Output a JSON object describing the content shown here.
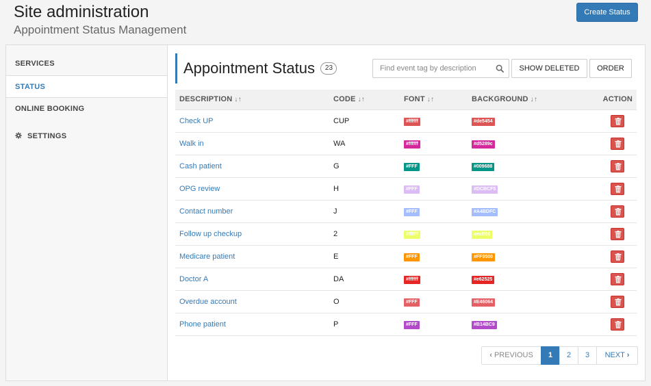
{
  "header": {
    "title": "Site administration",
    "subtitle": "Appointment Status Management",
    "create_label": "Create Status"
  },
  "sidebar": {
    "items": [
      {
        "label": "SERVICES"
      },
      {
        "label": "STATUS"
      },
      {
        "label": "ONLINE BOOKING"
      },
      {
        "label": "SETTINGS",
        "icon": "gear-icon"
      }
    ],
    "active_index": 1
  },
  "panel": {
    "title": "Appointment Status",
    "count": "23",
    "search_placeholder": "Find event tag by description",
    "show_deleted_label": "SHOW DELETED",
    "order_label": "ORDER"
  },
  "table": {
    "headers": {
      "description": "DESCRIPTION",
      "code": "CODE",
      "font": "FONT",
      "background": "BACKGROUND",
      "action": "ACTION"
    },
    "rows": [
      {
        "description": "Check UP",
        "code": "CUP",
        "font": "#ffffff",
        "background": "#de5454"
      },
      {
        "description": "Walk in",
        "code": "WA",
        "font": "#ffffff",
        "background": "#d5289c"
      },
      {
        "description": "Cash patient",
        "code": "G",
        "font": "#FFF",
        "background": "#009688"
      },
      {
        "description": "OPG review",
        "code": "H",
        "font": "#FFF",
        "background": "#DCBCF5"
      },
      {
        "description": "Contact number",
        "code": "J",
        "font": "#FFF",
        "background": "#A4BDFC"
      },
      {
        "description": "Follow up checkup",
        "code": "2",
        "font": "#ffffff",
        "background": "#ecff66"
      },
      {
        "description": "Medicare patient",
        "code": "E",
        "font": "#FFF",
        "background": "#FF9500"
      },
      {
        "description": "Doctor A",
        "code": "DA",
        "font": "#ffffff",
        "background": "#e62525"
      },
      {
        "description": "Overdue account",
        "code": "O",
        "font": "#FFF",
        "background": "#E46064"
      },
      {
        "description": "Phone patient",
        "code": "P",
        "font": "#FFF",
        "background": "#B14BC9"
      }
    ]
  },
  "pagination": {
    "previous_label": "PREVIOUS",
    "next_label": "NEXT",
    "pages": [
      "1",
      "2",
      "3"
    ],
    "active_page": "1"
  },
  "colors": {
    "accent": "#337ab7",
    "delete": "#d9534f"
  }
}
